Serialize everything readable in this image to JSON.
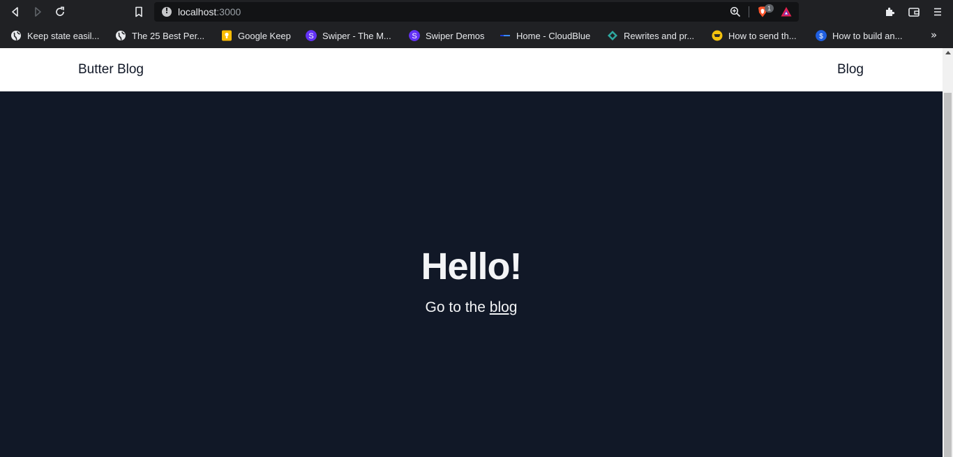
{
  "browser": {
    "url_host": "localhost",
    "url_port": ":3000",
    "shield_count": "1",
    "colors": {
      "toolbar_bg": "#202124",
      "urlbar_bg": "#121315",
      "brave_orange": "#fb542b"
    }
  },
  "bookmarks": [
    {
      "label": "Keep state easil...",
      "icon": "globe-icon"
    },
    {
      "label": "The 25 Best Per...",
      "icon": "globe-icon"
    },
    {
      "label": "Google Keep",
      "icon": "google-keep-icon"
    },
    {
      "label": "Swiper - The M...",
      "icon": "swiper-icon"
    },
    {
      "label": "Swiper Demos",
      "icon": "swiper-icon"
    },
    {
      "label": "Home - CloudBlue",
      "icon": "cloudblue-icon"
    },
    {
      "label": "Rewrites and pr...",
      "icon": "rewrites-icon"
    },
    {
      "label": "How to send th...",
      "icon": "site-icon"
    },
    {
      "label": "How to build an...",
      "icon": "site-icon"
    }
  ],
  "site": {
    "logo": "Butter Blog",
    "nav_blog": "Blog",
    "hero_title": "Hello!",
    "hero_sub_prefix": "Go to the",
    "hero_sub_link": "blog",
    "colors": {
      "header_bg": "#ffffff",
      "page_bg": "#111827",
      "text_light": "#f3f4f6",
      "text_dark": "#111827"
    }
  }
}
